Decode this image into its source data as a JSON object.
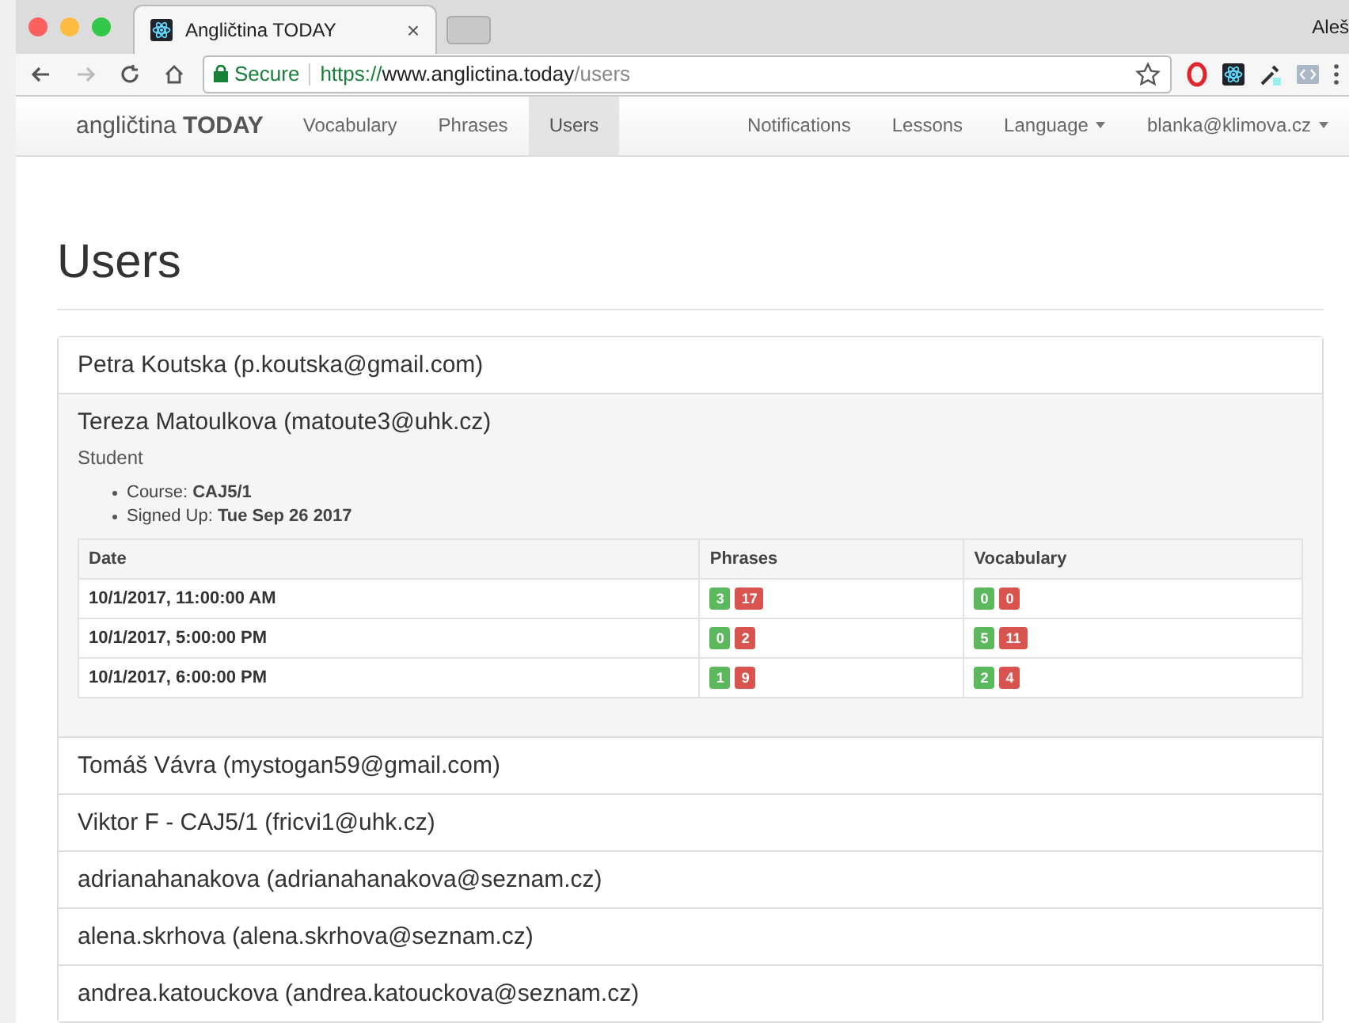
{
  "browser": {
    "tab": {
      "title": "Angličtina TODAY",
      "close": "×"
    },
    "profile": "Aleš",
    "address": {
      "secure": "Secure",
      "scheme": "https://",
      "host": "www.anglictina.today",
      "path": "/users"
    }
  },
  "navbar": {
    "brand": "angličtina **TODAY**",
    "left_items": [
      {
        "label": "Vocabulary",
        "selected": false
      },
      {
        "label": "Phrases",
        "selected": false
      },
      {
        "label": "Users",
        "selected": true
      }
    ],
    "right_items": [
      {
        "label": "Notifications",
        "dropdown": false
      },
      {
        "label": "Lessons",
        "dropdown": false
      },
      {
        "label": "Language",
        "dropdown": true
      },
      {
        "label": "blanka@klimova.cz",
        "dropdown": true
      }
    ]
  },
  "page_title": "Users",
  "users": [
    {
      "name": "Petra Koutska (p.koutska@gmail.com)",
      "expanded": false
    },
    {
      "name": "Tereza Matoulkova (matoute3@uhk.cz)",
      "expanded": true,
      "role": "Student",
      "details": [
        {
          "label": "Course:",
          "value": "CAJ5/1"
        },
        {
          "label": "Signed Up:",
          "value": "Tue Sep 26 2017"
        }
      ],
      "table": {
        "columns": [
          "Date",
          "Phrases",
          "Vocabulary"
        ],
        "rows": [
          {
            "date": "10/1/2017, 11:00:00 AM",
            "phrases": {
              "correct": "3",
              "wrong": "17"
            },
            "vocabulary": {
              "correct": "0",
              "wrong": "0"
            }
          },
          {
            "date": "10/1/2017, 5:00:00 PM",
            "phrases": {
              "correct": "0",
              "wrong": "2"
            },
            "vocabulary": {
              "correct": "5",
              "wrong": "11"
            }
          },
          {
            "date": "10/1/2017, 6:00:00 PM",
            "phrases": {
              "correct": "1",
              "wrong": "9"
            },
            "vocabulary": {
              "correct": "2",
              "wrong": "4"
            }
          }
        ]
      }
    },
    {
      "name": "Tomáš Vávra (mystogan59@gmail.com)",
      "expanded": false
    },
    {
      "name": "Viktor F - CAJ5/1 (fricvi1@uhk.cz)",
      "expanded": false
    },
    {
      "name": "adrianahanakova (adrianahanakova@seznam.cz)",
      "expanded": false
    },
    {
      "name": "alena.skrhova (alena.skrhova@seznam.cz)",
      "expanded": false
    },
    {
      "name": "andrea.katouckova (andrea.katouckova@seznam.cz)",
      "expanded": false
    }
  ]
}
